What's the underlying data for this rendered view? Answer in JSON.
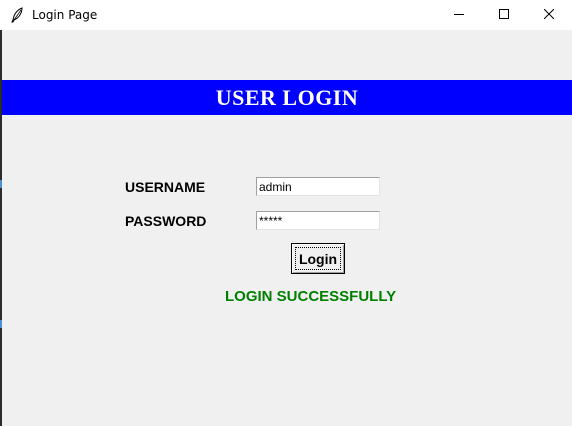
{
  "window": {
    "title": "Login Page",
    "icon": "feather-icon",
    "controls": [
      "minimize-icon",
      "maximize-icon",
      "close-icon"
    ]
  },
  "banner": {
    "text": "USER LOGIN",
    "background": "#0000ff",
    "color": "#ffffff"
  },
  "form": {
    "username_label": "USERNAME",
    "username_value": "admin",
    "password_label": "PASSWORD",
    "password_value": "*****",
    "login_label": "Login"
  },
  "status": {
    "text": "LOGIN SUCCESSFULLY",
    "color": "#008000"
  }
}
